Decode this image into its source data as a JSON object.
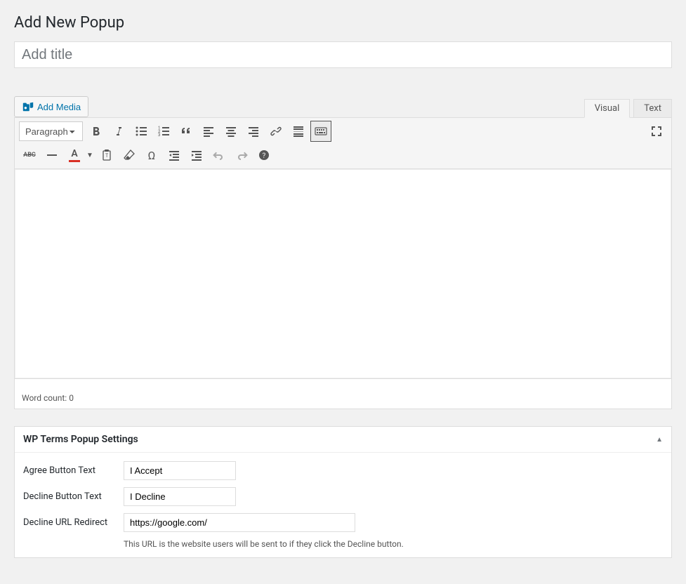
{
  "page": {
    "title": "Add New Popup"
  },
  "title_field": {
    "placeholder": "Add title",
    "value": ""
  },
  "media_button": {
    "label": "Add Media"
  },
  "editor_tabs": {
    "visual": "Visual",
    "text": "Text"
  },
  "format_select": {
    "value": "Paragraph"
  },
  "statusbar": {
    "word_count_label": "Word count:",
    "word_count": "0"
  },
  "metabox": {
    "title": "WP Terms Popup Settings",
    "agree_label": "Agree Button Text",
    "agree_value": "I Accept",
    "decline_label": "Decline Button Text",
    "decline_value": "I Decline",
    "redirect_label": "Decline URL Redirect",
    "redirect_value": "https://google.com/",
    "redirect_help": "This URL is the website users will be sent to if they click the Decline button."
  },
  "toolbar": {
    "row1": [
      "bold",
      "italic",
      "bulleted-list",
      "numbered-list",
      "blockquote",
      "align-left",
      "align-center",
      "align-right",
      "link",
      "read-more",
      "toolbar-toggle"
    ],
    "row2": [
      "strikethrough",
      "horizontal-rule",
      "text-color",
      "paste-text",
      "clear-formatting",
      "special-character",
      "outdent",
      "indent",
      "undo",
      "redo",
      "help"
    ],
    "fullscreen": "fullscreen"
  }
}
